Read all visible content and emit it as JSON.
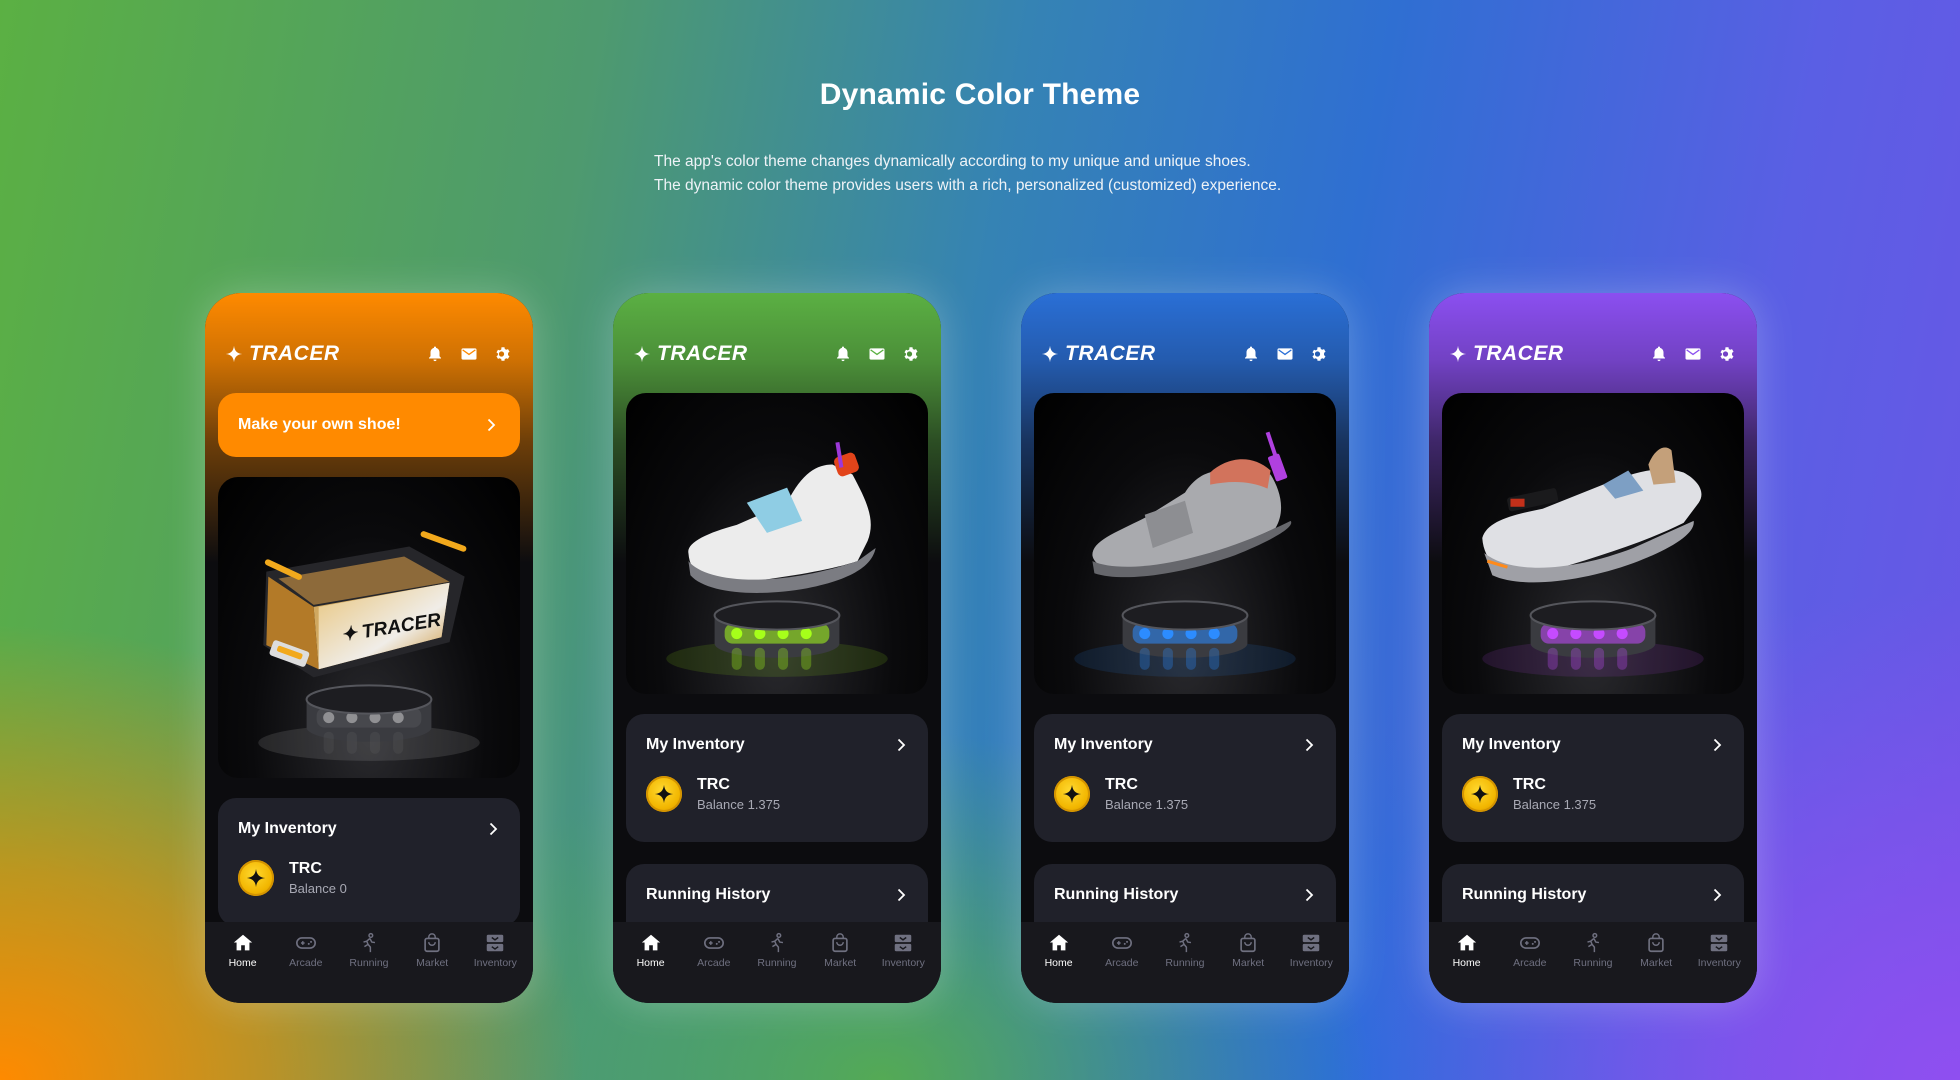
{
  "header": {
    "title": "Dynamic Color Theme",
    "description_line1": "The app's color theme changes dynamically according to my unique and unique shoes.",
    "description_line2": "The dynamic color theme provides users with a rich, personalized (customized) experience."
  },
  "phones": [
    {
      "theme": "orange",
      "accent": "#ff8a00",
      "logo": "TRACER",
      "top_icons": [
        "bell-icon",
        "mail-icon",
        "gear-icon"
      ],
      "cta": "Make your own shoe!",
      "hero": "mystery-box",
      "glow": "#e8e8e8",
      "inventory": {
        "title": "My Inventory",
        "coin": "TRC",
        "balance": "Balance 0"
      },
      "tabs": [
        "Home",
        "Arcade",
        "Running",
        "Market",
        "Inventory"
      ]
    },
    {
      "theme": "green",
      "accent": "#5bb043",
      "logo": "TRACER",
      "top_icons": [
        "bell-icon",
        "mail-icon",
        "gear-icon"
      ],
      "hero": "sneaker-white",
      "glow": "#a6ff1a",
      "inventory": {
        "title": "My Inventory",
        "coin": "TRC",
        "balance": "Balance 1.375"
      },
      "history": {
        "title": "Running History"
      },
      "tabs": [
        "Home",
        "Arcade",
        "Running",
        "Market",
        "Inventory"
      ]
    },
    {
      "theme": "blue",
      "accent": "#2a6fd6",
      "logo": "TRACER",
      "top_icons": [
        "bell-icon",
        "mail-icon",
        "gear-icon"
      ],
      "hero": "sneaker-silver",
      "glow": "#2c8cff",
      "inventory": {
        "title": "My Inventory",
        "coin": "TRC",
        "balance": "Balance 1.375"
      },
      "history": {
        "title": "Running History"
      },
      "tabs": [
        "Home",
        "Arcade",
        "Running",
        "Market",
        "Inventory"
      ]
    },
    {
      "theme": "purple",
      "accent": "#8b4ff0",
      "logo": "TRACER",
      "top_icons": [
        "bell-icon",
        "mail-icon",
        "gear-icon"
      ],
      "hero": "sneaker-vehicle",
      "glow": "#c54bff",
      "inventory": {
        "title": "My Inventory",
        "coin": "TRC",
        "balance": "Balance 1.375"
      },
      "history": {
        "title": "Running History"
      },
      "tabs": [
        "Home",
        "Arcade",
        "Running",
        "Market",
        "Inventory"
      ]
    }
  ]
}
